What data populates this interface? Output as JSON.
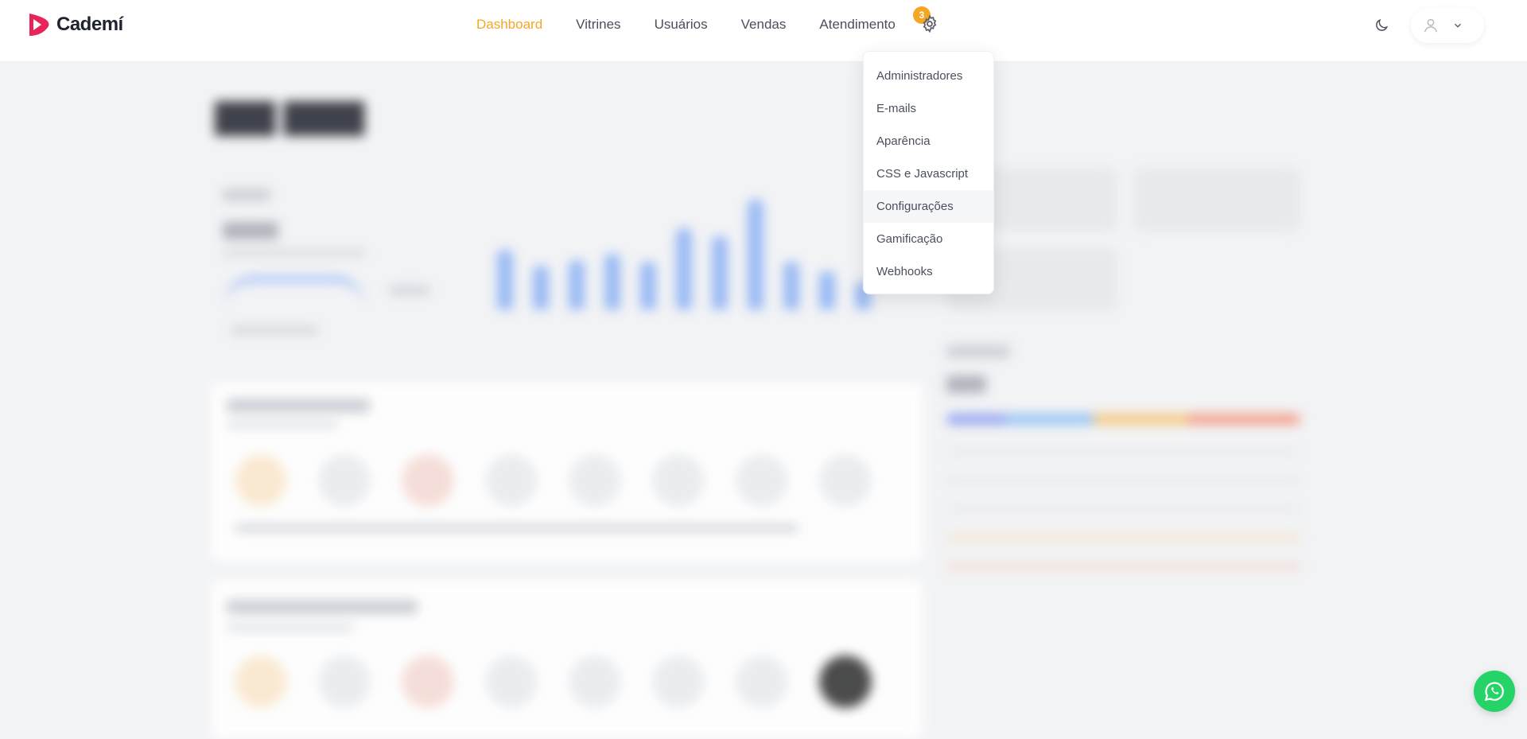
{
  "app": {
    "name": "Cademí",
    "brand_color": "#e8245a",
    "accent_color": "#f5a623"
  },
  "nav": {
    "items": [
      {
        "label": "Dashboard",
        "active": true
      },
      {
        "label": "Vitrines"
      },
      {
        "label": "Usuários"
      },
      {
        "label": "Vendas"
      },
      {
        "label": "Atendimento",
        "badge": "3"
      }
    ],
    "settings_icon": "gear-icon",
    "theme_icon": "moon-icon",
    "user_icon": "user-icon"
  },
  "settings_menu": {
    "items": [
      {
        "label": "Administradores"
      },
      {
        "label": "E-mails"
      },
      {
        "label": "Aparência"
      },
      {
        "label": "CSS e Javascript"
      },
      {
        "label": "Configurações",
        "hovered": true
      },
      {
        "label": "Gamificação"
      },
      {
        "label": "Webhooks"
      }
    ]
  },
  "whatsapp": {
    "icon": "whatsapp-icon",
    "color": "#25d366"
  }
}
